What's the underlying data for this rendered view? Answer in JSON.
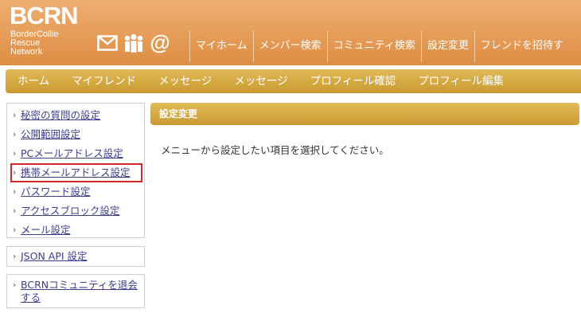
{
  "logo": {
    "mark": "BCRN",
    "lines": [
      "BorderCollie",
      "Rescue",
      "Network"
    ]
  },
  "header_icons": [
    "mail-icon",
    "members-icon",
    "at-icon"
  ],
  "top_nav": [
    "マイホーム",
    "メンバー検索",
    "コミュニティ検索",
    "設定変更",
    "フレンドを招待す"
  ],
  "sub_nav": [
    "ホーム",
    "マイフレンド",
    "メッセージ",
    "メッセージ",
    "プロフィール確認",
    "プロフィール編集"
  ],
  "sidebar": {
    "settings": [
      "秘密の質問の設定",
      "公開範囲設定",
      "PCメールアドレス設定",
      "携帯メールアドレス設定",
      "パスワード設定",
      "アクセスブロック設定",
      "メール設定"
    ],
    "api": "JSON API 設定",
    "leave": "BCRNコミュニティを退会する",
    "arrow": "›"
  },
  "panel": {
    "title": "設定変更",
    "message": "メニューから設定したい項目を選択してください。"
  }
}
